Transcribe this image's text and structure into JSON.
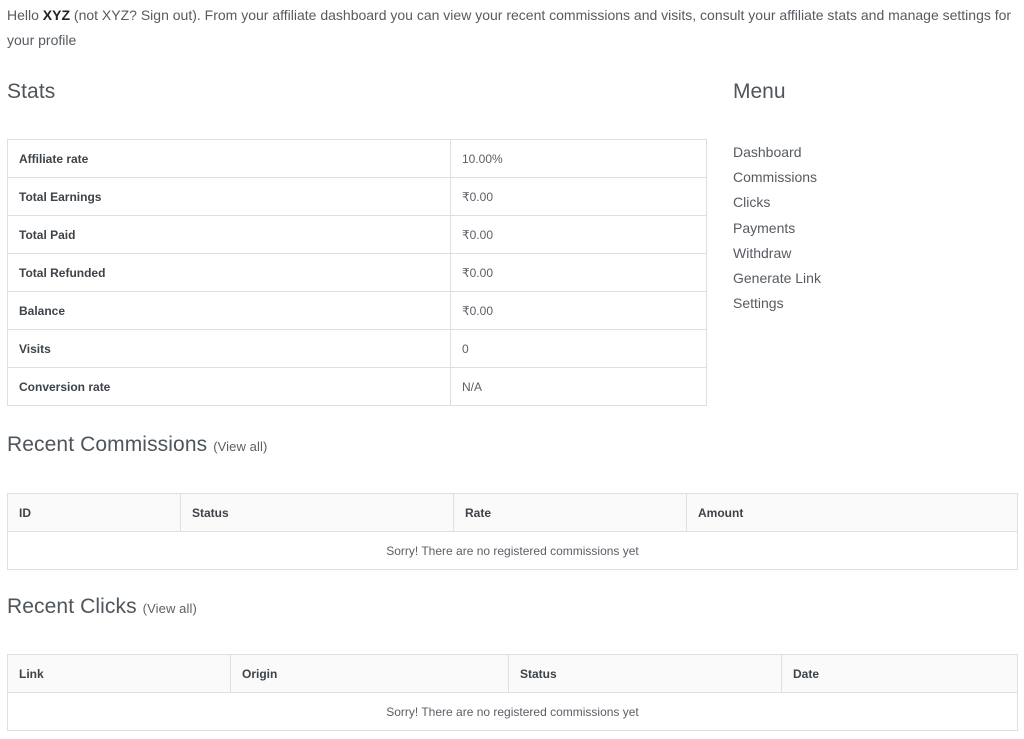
{
  "intro": {
    "hello": "Hello",
    "username": "XYZ",
    "not_text": "(not XYZ?",
    "signout": "Sign out",
    "rest": "). From your affiliate dashboard you can view your recent commissions and visits, consult your affiliate stats and manage settings for your profile"
  },
  "stats": {
    "title": "Stats",
    "rows": [
      {
        "label": "Affiliate rate",
        "value": "10.00%"
      },
      {
        "label": "Total Earnings",
        "value": "₹0.00"
      },
      {
        "label": "Total Paid",
        "value": "₹0.00"
      },
      {
        "label": "Total Refunded",
        "value": "₹0.00"
      },
      {
        "label": "Balance",
        "value": "₹0.00"
      },
      {
        "label": "Visits",
        "value": "0"
      },
      {
        "label": "Conversion rate",
        "value": "N/A"
      }
    ]
  },
  "menu": {
    "title": "Menu",
    "items": [
      "Dashboard",
      "Commissions",
      "Clicks",
      "Payments",
      "Withdraw",
      "Generate Link",
      "Settings"
    ]
  },
  "commissions": {
    "title": "Recent Commissions",
    "view_all": "(View all)",
    "headers": [
      "ID",
      "Status",
      "Rate",
      "Amount"
    ],
    "empty": "Sorry! There are no registered commissions yet"
  },
  "clicks": {
    "title": "Recent Clicks",
    "view_all": "(View all)",
    "headers": [
      "Link",
      "Origin",
      "Status",
      "Date"
    ],
    "empty": "Sorry! There are no registered commissions yet"
  }
}
